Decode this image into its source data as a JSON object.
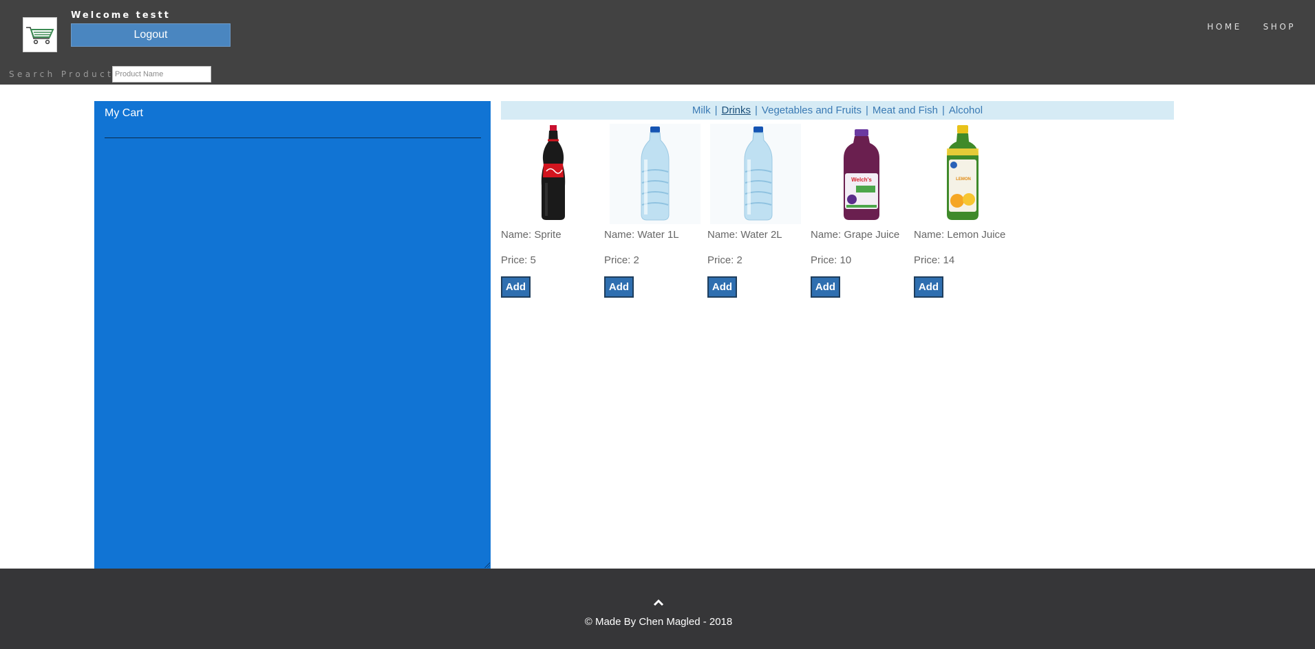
{
  "header": {
    "welcome": "Welcome testt",
    "logout_label": "Logout",
    "logo_icon": "shopping-cart-icon",
    "nav": [
      {
        "label": "HOME"
      },
      {
        "label": "SHOP"
      }
    ],
    "search": {
      "label": "Search Products",
      "placeholder": "Product Name",
      "value": ""
    }
  },
  "cart": {
    "title": "My Cart",
    "background": "#1174d4"
  },
  "categories": {
    "items": [
      {
        "label": "Milk",
        "active": false
      },
      {
        "label": "Drinks",
        "active": true
      },
      {
        "label": "Vegetables and Fruits",
        "active": false
      },
      {
        "label": "Meat and Fish",
        "active": false
      },
      {
        "label": "Alcohol",
        "active": false
      }
    ]
  },
  "products": [
    {
      "name": "Name: Sprite",
      "price": "Price: 5",
      "add_label": "Add",
      "image": "cola-bottle-image"
    },
    {
      "name": "Name: Water 1L",
      "price": "Price: 2",
      "add_label": "Add",
      "image": "water-bottle-image"
    },
    {
      "name": "Name: Water 2L",
      "price": "Price: 2",
      "add_label": "Add",
      "image": "water-bottle-image"
    },
    {
      "name": "Name: Grape Juice",
      "price": "Price: 10",
      "add_label": "Add",
      "image": "grape-juice-image"
    },
    {
      "name": "Name: Lemon Juice",
      "price": "Price: 14",
      "add_label": "Add",
      "image": "lemon-juice-image"
    }
  ],
  "footer": {
    "copyright": "© Made By Chen Magled - 2018",
    "up_icon": "chevron-up-icon"
  },
  "colors": {
    "header_bg": "#424242",
    "footer_bg": "#363638",
    "button_blue": "#2f6fb0",
    "category_bar_bg": "#d6ebf5"
  }
}
